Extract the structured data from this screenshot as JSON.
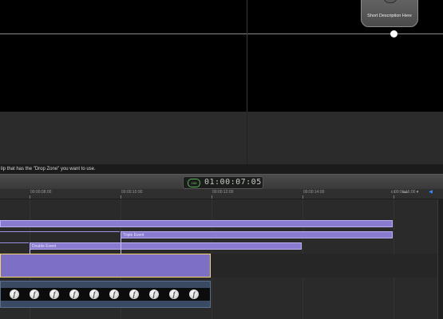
{
  "viewer": {
    "tile_label": "Short Description Here"
  },
  "help_bar": {
    "text": "lip that has the \"Drop Zone\" you want to use."
  },
  "timecode": {
    "badge": "100",
    "value": "01:00:07:05"
  },
  "ruler": {
    "ticks": [
      "00:00:08:00",
      "00:00:10:00",
      "00:00:12:00",
      "00:00:14:00",
      "00:00:16:00"
    ]
  },
  "timeline": {
    "clips": {
      "top_bar_label": "",
      "triple_event_label": "Triple Event",
      "double_event_label": "Double Event"
    },
    "audio_icons": [
      "f",
      "f",
      "f",
      "f",
      "f",
      "f",
      "f",
      "f",
      "f",
      "f"
    ]
  },
  "colors": {
    "clip_purple": "#8a7ad0",
    "selection_yellow": "#f3d36c",
    "timecode_green": "#59b35a",
    "audio_blue": "#3b4a63"
  },
  "icons": [
    "tile-icon",
    "timecode-badge-icon",
    "clip-appearance-icon",
    "skimming-icon",
    "audio-skimming-icon",
    "snapping-icon",
    "facebook-icon"
  ]
}
